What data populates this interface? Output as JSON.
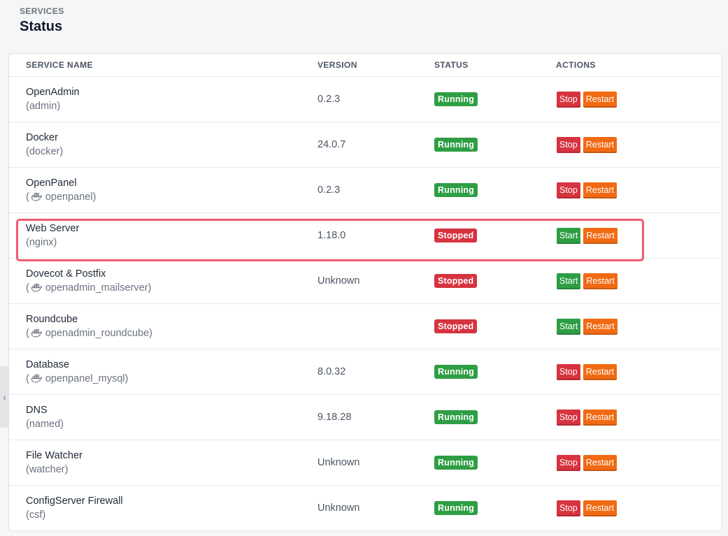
{
  "header": {
    "kicker": "SERVICES",
    "title": "Status"
  },
  "table": {
    "columns": {
      "name": "SERVICE NAME",
      "version": "VERSION",
      "status": "STATUS",
      "actions": "ACTIONS"
    },
    "rows": [
      {
        "name": "OpenAdmin",
        "sub_prefix": "(",
        "sub_text": "admin)",
        "docker": false,
        "version": "0.2.3",
        "status": "Running",
        "primary_action": "Stop",
        "secondary_action": "Restart"
      },
      {
        "name": "Docker",
        "sub_prefix": "(",
        "sub_text": "docker)",
        "docker": false,
        "version": "24.0.7",
        "status": "Running",
        "primary_action": "Stop",
        "secondary_action": "Restart"
      },
      {
        "name": "OpenPanel",
        "sub_prefix": "(",
        "sub_text": "openpanel)",
        "docker": true,
        "version": "0.2.3",
        "status": "Running",
        "primary_action": "Stop",
        "secondary_action": "Restart"
      },
      {
        "name": "Web Server",
        "sub_prefix": "(",
        "sub_text": "nginx)",
        "docker": false,
        "version": "1.18.0",
        "status": "Stopped",
        "primary_action": "Start",
        "secondary_action": "Restart"
      },
      {
        "name": "Dovecot & Postfix",
        "sub_prefix": "(",
        "sub_text": "openadmin_mailserver)",
        "docker": true,
        "version": "Unknown",
        "status": "Stopped",
        "primary_action": "Start",
        "secondary_action": "Restart"
      },
      {
        "name": "Roundcube",
        "sub_prefix": "(",
        "sub_text": "openadmin_roundcube)",
        "docker": true,
        "version": "",
        "status": "Stopped",
        "primary_action": "Start",
        "secondary_action": "Restart"
      },
      {
        "name": "Database",
        "sub_prefix": "(",
        "sub_text": "openpanel_mysql)",
        "docker": true,
        "version": "8.0.32",
        "status": "Running",
        "primary_action": "Stop",
        "secondary_action": "Restart"
      },
      {
        "name": "DNS",
        "sub_prefix": "(",
        "sub_text": "named)",
        "docker": false,
        "version": "9.18.28",
        "status": "Running",
        "primary_action": "Stop",
        "secondary_action": "Restart"
      },
      {
        "name": "File Watcher",
        "sub_prefix": "(",
        "sub_text": "watcher)",
        "docker": false,
        "version": "Unknown",
        "status": "Running",
        "primary_action": "Stop",
        "secondary_action": "Restart"
      },
      {
        "name": "ConfigServer Firewall",
        "sub_prefix": "(",
        "sub_text": "csf)",
        "docker": false,
        "version": "Unknown",
        "status": "Running",
        "primary_action": "Stop",
        "secondary_action": "Restart"
      }
    ]
  },
  "icons": {
    "docker": "docker-whale-icon",
    "collapse": "chevron-left-icon"
  },
  "colors": {
    "running": "#2e9e44",
    "stopped": "#d6333f",
    "stop_button": "#d6333f",
    "start_button": "#2e9e44",
    "restart_button": "#f16a13",
    "highlight": "#ef5a6f"
  }
}
